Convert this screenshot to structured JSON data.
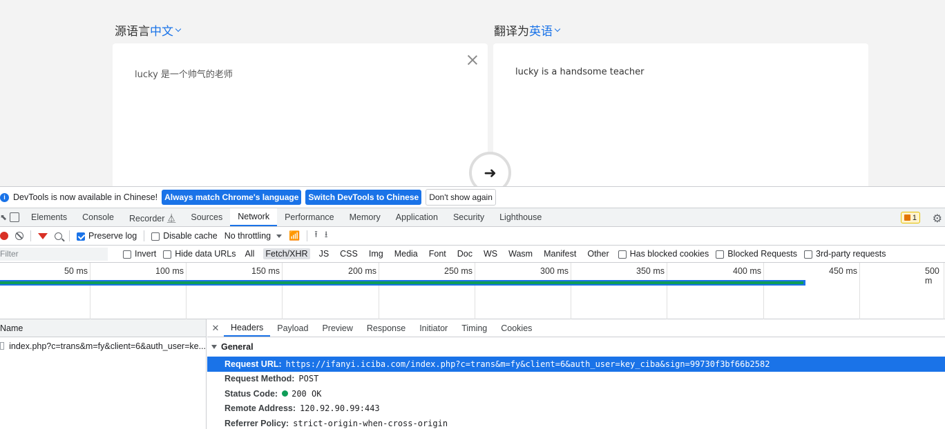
{
  "translator": {
    "source_prefix": "源语言",
    "source_lang": "中文",
    "target_prefix": "翻译为",
    "target_lang": "英语",
    "input_text": "lucky 是一个帅气的老师",
    "output_text": "lucky is a handsome teacher"
  },
  "infobar": {
    "message": "DevTools is now available in Chinese!",
    "btn_match": "Always match Chrome's language",
    "btn_switch": "Switch DevTools to Chinese",
    "btn_dismiss": "Don't show again"
  },
  "tabs": [
    "Elements",
    "Console",
    "Recorder ⏅",
    "Sources",
    "Network",
    "Performance",
    "Memory",
    "Application",
    "Security",
    "Lighthouse"
  ],
  "warning_count": "1",
  "toolbar": {
    "preserve_log": "Preserve log",
    "disable_cache": "Disable cache",
    "throttling": "No throttling"
  },
  "filterbar": {
    "filter_placeholder": "Filter",
    "invert": "Invert",
    "hide_data_urls": "Hide data URLs",
    "types": [
      "All",
      "Fetch/XHR",
      "JS",
      "CSS",
      "Img",
      "Media",
      "Font",
      "Doc",
      "WS",
      "Wasm",
      "Manifest",
      "Other"
    ],
    "has_blocked_cookies": "Has blocked cookies",
    "blocked_requests": "Blocked Requests",
    "third_party": "3rd-party requests"
  },
  "timeline": {
    "ticks": [
      "50 ms",
      "100 ms",
      "150 ms",
      "200 ms",
      "250 ms",
      "300 ms",
      "350 ms",
      "400 ms",
      "450 ms",
      "500 m"
    ]
  },
  "requests": {
    "header": "Name",
    "rows": [
      "index.php?c=trans&m=fy&client=6&auth_user=ke..."
    ]
  },
  "detail": {
    "tabs": [
      "Headers",
      "Payload",
      "Preview",
      "Response",
      "Initiator",
      "Timing",
      "Cookies"
    ],
    "section": "General",
    "request_url_label": "Request URL:",
    "request_url": "https://ifanyi.iciba.com/index.php?c=trans&m=fy&client=6&auth_user=key_ciba&sign=99730f3bf66b2582",
    "method_label": "Request Method:",
    "method": "POST",
    "status_label": "Status Code:",
    "status": "200 OK",
    "remote_label": "Remote Address:",
    "remote": "120.92.90.99:443",
    "referrer_label": "Referrer Policy:",
    "referrer": "strict-origin-when-cross-origin"
  }
}
